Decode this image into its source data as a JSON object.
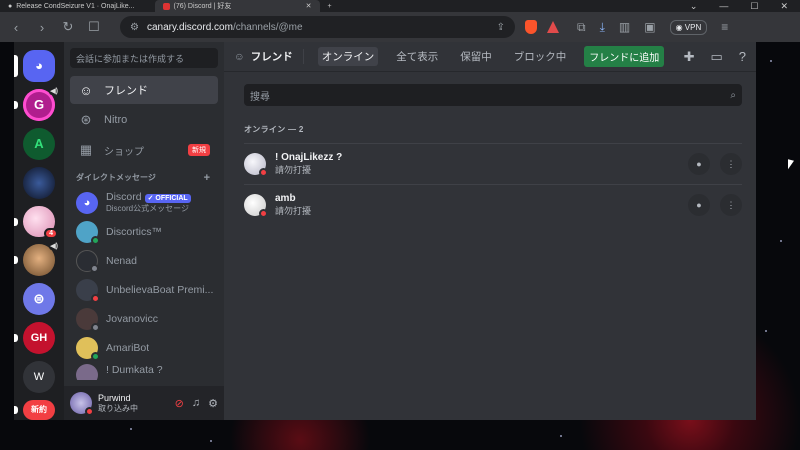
{
  "browser": {
    "tabs": [
      {
        "title": "Release CondSeizure V1 · OnajLike..."
      },
      {
        "title": "(76) Discord | 好友"
      }
    ],
    "new_tab": "+",
    "url_host": "canary.discord.com",
    "url_path": "/channels/@me",
    "brave_badge": "1",
    "vpn_label": "VPN"
  },
  "guilds": [
    {
      "name": "home",
      "label": "",
      "color": "#5865f2"
    },
    {
      "name": "G-server",
      "label": "G",
      "color": "#b01e8e"
    },
    {
      "name": "A-server",
      "label": "A",
      "color": "#0f5b2f"
    },
    {
      "name": "dark-server",
      "label": "",
      "color": "#1b2a4d"
    },
    {
      "name": "anime-server",
      "label": "",
      "color": "#f0b8d0",
      "badge": "4"
    },
    {
      "name": "face-server",
      "label": "",
      "color": "#c9925a"
    },
    {
      "name": "o-server",
      "label": "",
      "color": "#6f78e8"
    },
    {
      "name": "gh-server",
      "label": "GH",
      "color": "#c4122e"
    },
    {
      "name": "w-server",
      "label": "W",
      "color": "#313338"
    },
    {
      "name": "new-server",
      "label": "新約",
      "color": "#f23f43"
    }
  ],
  "sidebar": {
    "search_placeholder": "会話に参加または作成する",
    "nav": [
      {
        "label": "フレンド",
        "icon": "friends-icon"
      },
      {
        "label": "Nitro",
        "icon": "nitro-icon"
      },
      {
        "label": "ショップ",
        "icon": "shop-icon",
        "tag": "新規"
      }
    ],
    "dm_header": "ダイレクトメッセージ",
    "dm_add": "+",
    "dms": [
      {
        "name": "Discord",
        "official": "✓ OFFICIAL",
        "sub": "Discord公式メッセージ",
        "color": "#5865f2",
        "status": ""
      },
      {
        "name": "Discortics™",
        "color": "#4fa3c7",
        "status": "online"
      },
      {
        "name": "Nenad",
        "color": "#2a2d33",
        "status": "offline"
      },
      {
        "name": "UnbelievaBoat Premi...",
        "color": "#3a3f4a",
        "status": "dnd"
      },
      {
        "name": "Jovanovicc",
        "color": "#4a3a3a",
        "status": "offline"
      },
      {
        "name": "AmariBot",
        "color": "#e0c05a",
        "status": "online"
      },
      {
        "name": "! Dumkata ?",
        "color": "#7a6a8a",
        "status": "online"
      }
    ]
  },
  "user": {
    "name": "Purwind",
    "status": "取り込み中"
  },
  "topbar": {
    "title": "フレンド",
    "tabs": [
      "オンライン",
      "全て表示",
      "保留中",
      "ブロック中"
    ],
    "add_friend": "フレンドに追加"
  },
  "friends": {
    "search_placeholder": "搜尋",
    "count_label": "オンライン — 2",
    "list": [
      {
        "name": "! OnajLikezz ?",
        "status": "請勿打擾",
        "color": "#d8d8e0"
      },
      {
        "name": "amb",
        "status": "請勿打擾",
        "color": "#e6e6e6"
      }
    ]
  },
  "colors": {
    "accent": "#5865f2",
    "green": "#248046",
    "red": "#f23f43"
  }
}
